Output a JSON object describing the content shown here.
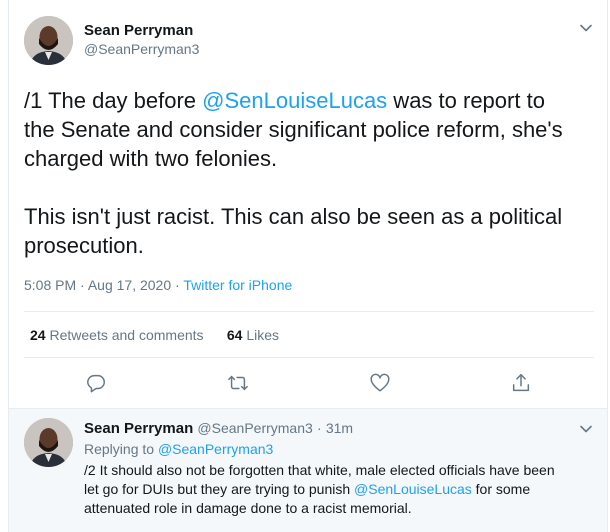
{
  "main_tweet": {
    "author_name": "Sean Perryman",
    "author_handle": "@SeanPerryman3",
    "body": {
      "l1_pre": "/1 The day before ",
      "l1_mention": "@SenLouiseLucas",
      "l1_post": " was to report to",
      "l2": "the Senate and consider significant police reform, she's",
      "l3": "charged with two felonies.",
      "l4": "This isn't just racist. This can also be seen as a political",
      "l5": "prosecution."
    },
    "time": "5:08 PM",
    "date": "Aug 17, 2020",
    "separator": "·",
    "source": "Twitter for iPhone",
    "retweets_count": "24",
    "retweets_label": "Retweets and comments",
    "likes_count": "64",
    "likes_label": "Likes",
    "actions": [
      "reply-icon",
      "retweet-icon",
      "like-icon",
      "share-icon"
    ]
  },
  "reply_tweet": {
    "author_name": "Sean Perryman",
    "author_handle": "@SeanPerryman3",
    "separator": "·",
    "time_ago": "31m",
    "replying_label": "Replying to",
    "replying_to": "@SeanPerryman3",
    "body": {
      "l1": "/2 It should also not be forgotten that white, male elected officials have been",
      "l2_pre": "let go for DUIs but they are trying to punish ",
      "l2_mention": "@SenLouiseLucas",
      "l2_post": " for some",
      "l3": "attenuated role in damage done to a racist memorial."
    }
  },
  "colors": {
    "link": "#1da1f2",
    "secondary_text": "#657786",
    "primary_text": "#14171a",
    "divider": "#e6ecf0",
    "reply_background": "#f5f8fa"
  }
}
